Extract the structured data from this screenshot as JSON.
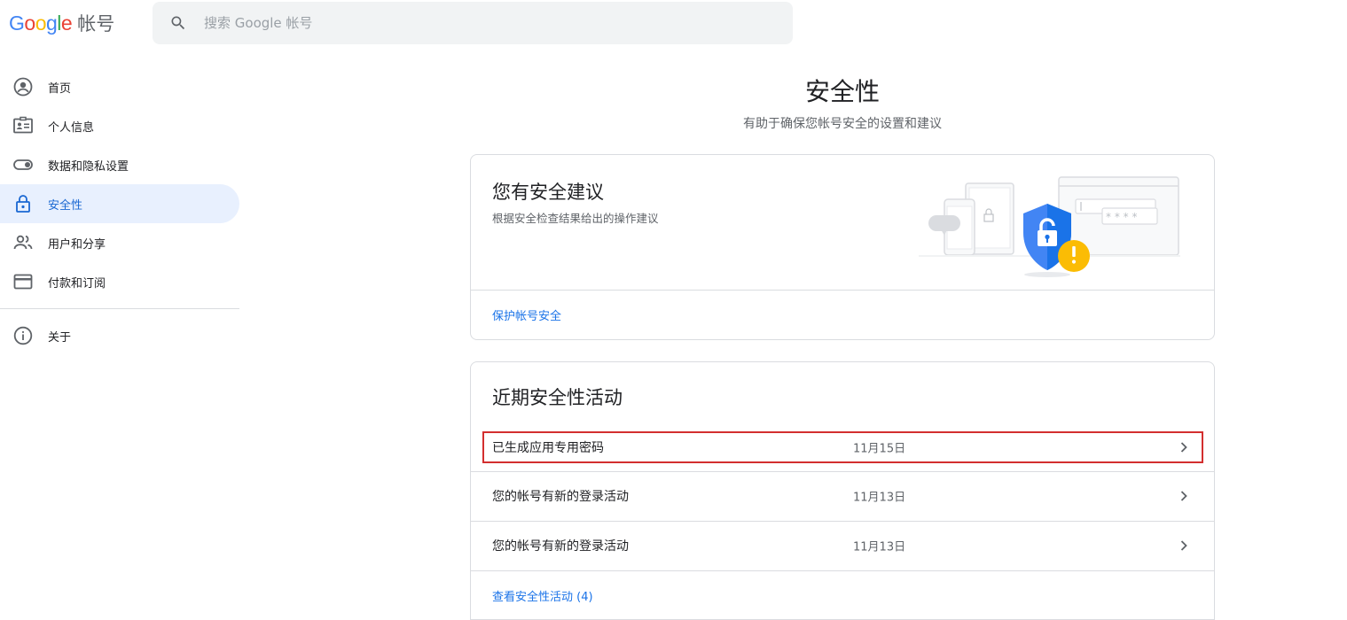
{
  "header": {
    "logo_google": "Google",
    "logo_product": "帐号",
    "search_placeholder": "搜索 Google 帐号"
  },
  "sidebar": {
    "items": [
      {
        "label": "首页",
        "icon": "account-circle-icon"
      },
      {
        "label": "个人信息",
        "icon": "id-card-icon"
      },
      {
        "label": "数据和隐私设置",
        "icon": "toggle-icon"
      },
      {
        "label": "安全性",
        "icon": "lock-icon",
        "active": true
      },
      {
        "label": "用户和分享",
        "icon": "people-icon"
      },
      {
        "label": "付款和订阅",
        "icon": "credit-card-icon"
      }
    ],
    "about_label": "关于",
    "about_icon": "info-icon"
  },
  "page": {
    "title": "安全性",
    "subtitle": "有助于确保您帐号安全的设置和建议"
  },
  "recommendations": {
    "title": "您有安全建议",
    "description": "根据安全检查结果给出的操作建议",
    "link": "保护帐号安全"
  },
  "activity": {
    "title": "近期安全性活动",
    "rows": [
      {
        "label": "已生成应用专用密码",
        "date": "11月15日"
      },
      {
        "label": "您的帐号有新的登录活动",
        "date": "11月13日"
      },
      {
        "label": "您的帐号有新的登录活动",
        "date": "11月13日"
      }
    ],
    "view_link": "查看安全性活动 (4)"
  },
  "colors": {
    "accent": "#1a73e8",
    "active_bg": "#e8f0fe",
    "highlight": "#d32f2f",
    "warning": "#fbbc04"
  }
}
